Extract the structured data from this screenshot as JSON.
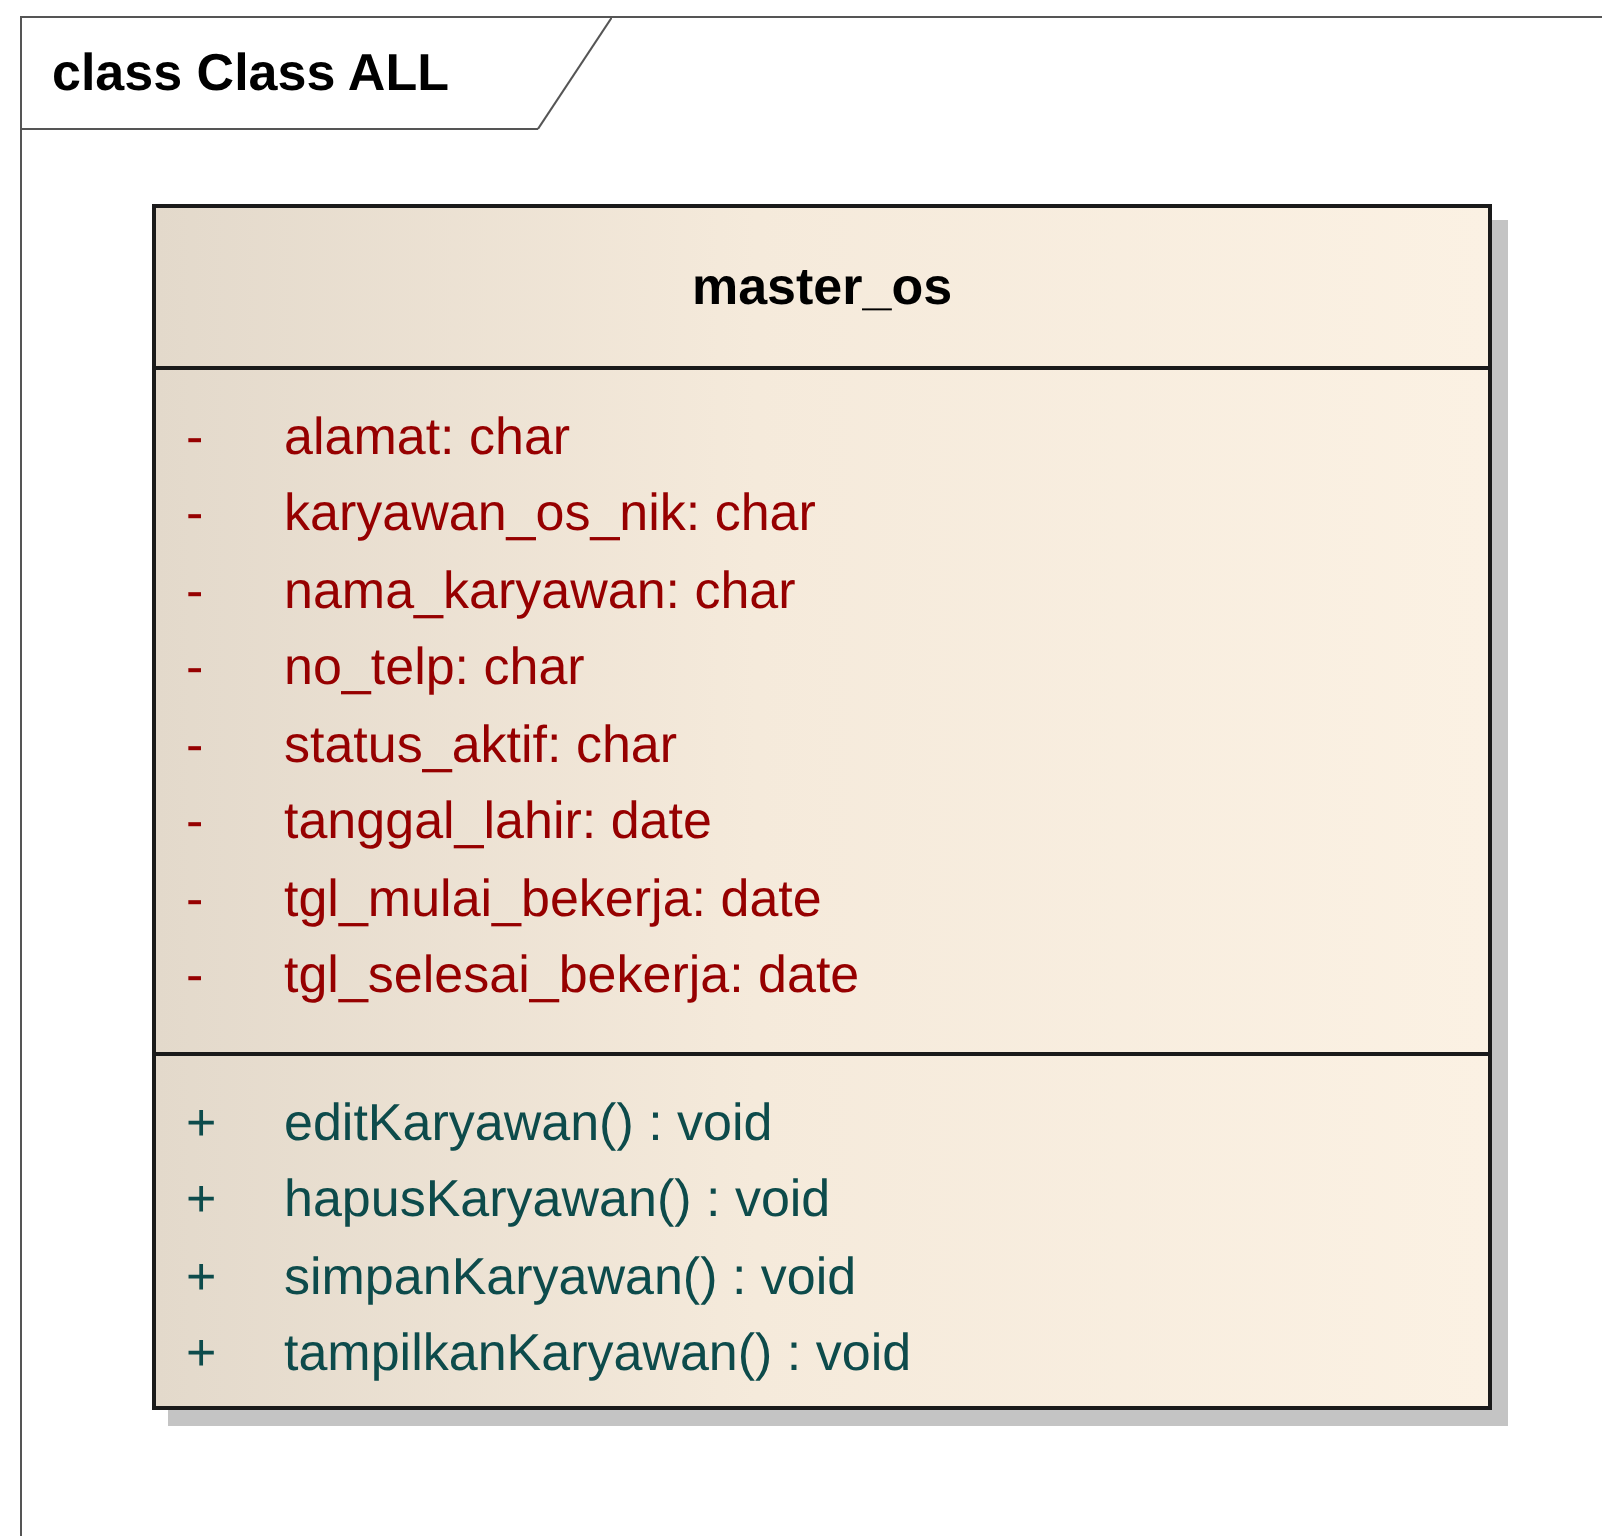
{
  "diagram": {
    "title": "class Class ALL"
  },
  "class": {
    "name": "master_os",
    "attributes": [
      {
        "visibility": "-",
        "text": "alamat: char"
      },
      {
        "visibility": "-",
        "text": "karyawan_os_nik: char"
      },
      {
        "visibility": "-",
        "text": "nama_karyawan: char"
      },
      {
        "visibility": "-",
        "text": "no_telp: char"
      },
      {
        "visibility": "-",
        "text": "status_aktif: char"
      },
      {
        "visibility": "-",
        "text": "tanggal_lahir: date"
      },
      {
        "visibility": "-",
        "text": "tgl_mulai_bekerja: date"
      },
      {
        "visibility": "-",
        "text": "tgl_selesai_bekerja: date"
      }
    ],
    "operations": [
      {
        "visibility": "+",
        "text": "editKaryawan() : void"
      },
      {
        "visibility": "+",
        "text": "hapusKaryawan() : void"
      },
      {
        "visibility": "+",
        "text": "simpanKaryawan() : void"
      },
      {
        "visibility": "+",
        "text": "tampilkanKaryawan() : void"
      }
    ]
  }
}
